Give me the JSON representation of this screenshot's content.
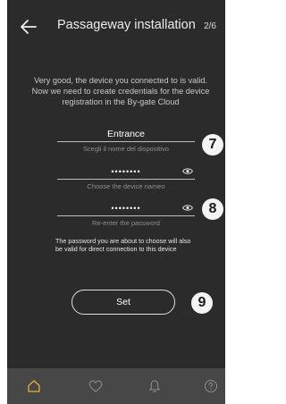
{
  "header": {
    "title": "Passageway installation",
    "step": "2/6"
  },
  "intro": "Very good, the device you connected to is valid. Now we need to create credentials for the device registration in the By-gate Cloud",
  "form": {
    "name_value": "Entrance",
    "name_hint": "Scegli il nome del dispositivo",
    "password_value": "••••••••",
    "password_hint": "Choose the device nameo",
    "confirm_value": "••••••••",
    "confirm_hint": "Re-enter the password"
  },
  "note": "The password you are about to choose will also be valid for direct connection to this device",
  "set_button": "Set",
  "badges": {
    "b7": "7",
    "b8": "8",
    "b9": "9"
  },
  "colors": {
    "background": "#2b2b2b",
    "tabbar": "#474747",
    "accent": "#e6b12e"
  },
  "tabs": [
    "home-icon",
    "heart-icon",
    "bell-icon",
    "help-icon"
  ]
}
